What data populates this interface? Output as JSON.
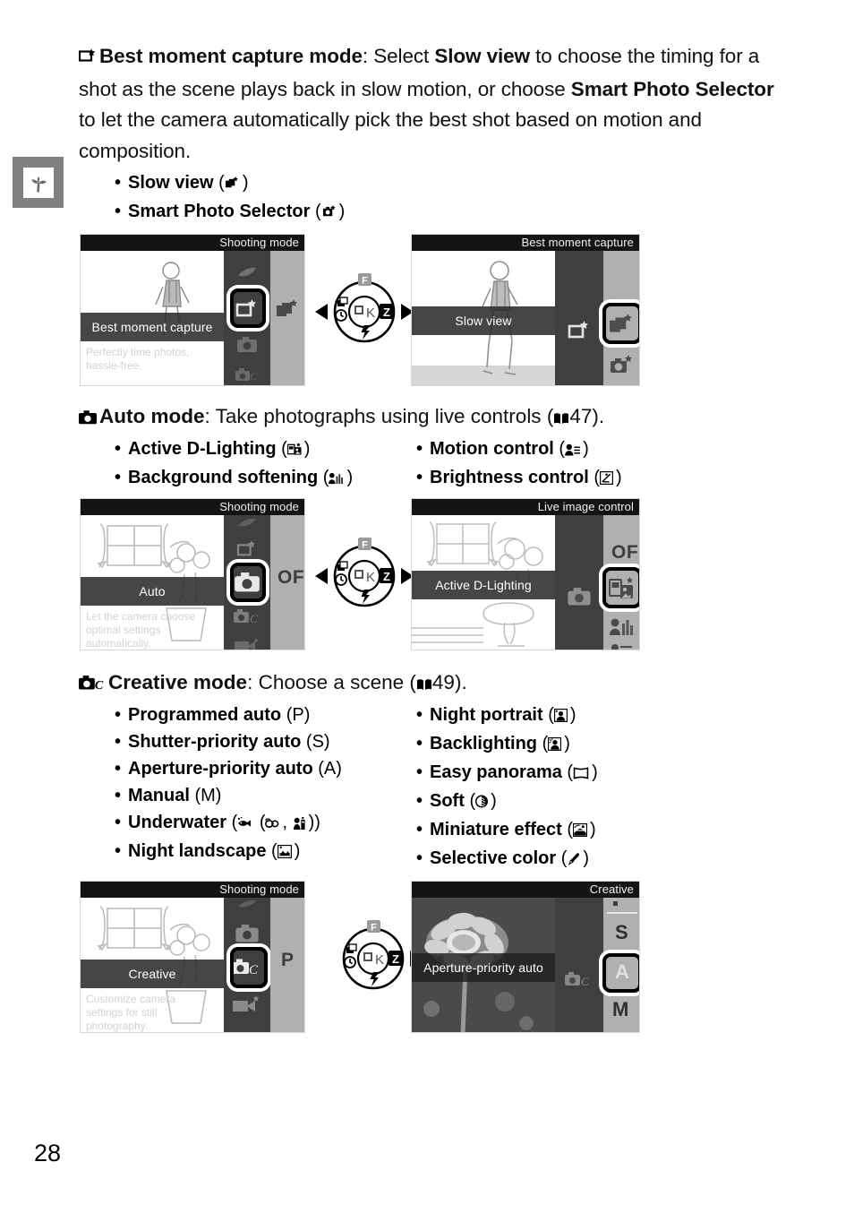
{
  "page": {
    "number": "28",
    "chapter_tab_icon": "sprout-icon"
  },
  "best_moment": {
    "heading_icon": "best-moment-capture-icon",
    "heading_bold": "Best moment capture mode",
    "heading_rest": ": Select ",
    "body_bold_1": "Slow view",
    "body_part_2": " to choose the timing for a shot as the scene plays back in slow motion, or choose ",
    "body_bold_2": "Smart Photo Selector",
    "body_part_3": " to let the camera automatically pick the best shot based on motion and composition.",
    "bullets": [
      {
        "label": "Slow view",
        "icon": "slow-view-icon"
      },
      {
        "label": "Smart Photo Selector",
        "icon": "smart-photo-selector-icon"
      }
    ],
    "shot_left": {
      "title": "Shooting mode",
      "selected_label": "Best moment capture",
      "description": "Perfectly time photos,\nhassle-free.",
      "strip_icons": [
        "effects-icon",
        "best-moment-capture-icon",
        "auto-camera-icon",
        "creative-camera-icon"
      ],
      "col2_icons": [
        "slow-view-icon"
      ]
    },
    "shot_right": {
      "title": "Best moment capture",
      "selected_label": "Slow view",
      "strip_icons": [
        "best-moment-capture-icon"
      ],
      "col2_icons": [
        "slow-view-icon",
        "smart-photo-selector-icon"
      ]
    }
  },
  "auto_mode": {
    "heading_icon": "auto-camera-icon",
    "heading_bold": "Auto mode",
    "heading_rest": ": Take photographs using live controls (",
    "page_ref": "47",
    "heading_tail": ").",
    "bullets_left": [
      {
        "label": "Active D-Lighting",
        "icon": "active-d-lighting-icon"
      },
      {
        "label": "Background softening",
        "icon": "background-softening-icon"
      }
    ],
    "bullets_right": [
      {
        "label": "Motion control",
        "icon": "motion-control-icon"
      },
      {
        "label": "Brightness control",
        "icon": "brightness-control-icon"
      }
    ],
    "shot_left": {
      "title": "Shooting mode",
      "selected_label": "Auto",
      "description": "Let the camera choose\noptimal settings\nautomatically.",
      "strip_icons": [
        "effects-icon",
        "best-moment-capture-icon",
        "auto-camera-icon",
        "creative-camera-icon",
        "movie-icon"
      ],
      "col2_text": "OFF"
    },
    "shot_right": {
      "title": "Live image control",
      "selected_label": "Active D-Lighting",
      "strip_icons": [
        "auto-camera-icon"
      ],
      "col2_text": "OFF",
      "col2_icons": [
        "active-d-lighting-icon",
        "background-softening-icon",
        "motion-control-icon"
      ]
    }
  },
  "creative_mode": {
    "heading_icon": "creative-camera-icon",
    "heading_bold": "Creative mode",
    "heading_rest": ": Choose a scene (",
    "page_ref": "49",
    "heading_tail": ").",
    "bullets_left": [
      {
        "label": "Programmed auto",
        "paren": "(P)"
      },
      {
        "label": "Shutter-priority auto",
        "paren": "(S)"
      },
      {
        "label": "Aperture-priority auto",
        "paren": "(A)"
      },
      {
        "label": "Manual",
        "paren": "(M)"
      },
      {
        "label": "Underwater",
        "paren": "(  (  ,  ))",
        "icons": [
          "underwater-fish-icon",
          "underwater-mask-icon",
          "underwater-diver-icon"
        ]
      },
      {
        "label": "Night landscape",
        "paren": "(  )",
        "icons": [
          "night-landscape-icon"
        ]
      }
    ],
    "bullets_right": [
      {
        "label": "Night portrait",
        "paren": "(  )",
        "icons": [
          "night-portrait-icon"
        ]
      },
      {
        "label": "Backlighting",
        "paren": "(  )",
        "icons": [
          "backlighting-icon"
        ]
      },
      {
        "label": "Easy panorama",
        "paren": "(  )",
        "icons": [
          "easy-panorama-icon"
        ]
      },
      {
        "label": "Soft",
        "paren": "(  )",
        "icons": [
          "soft-icon"
        ]
      },
      {
        "label": "Miniature effect",
        "paren": "(  )",
        "icons": [
          "miniature-effect-icon"
        ]
      },
      {
        "label": "Selective color",
        "paren": "(  )",
        "icons": [
          "selective-color-icon"
        ]
      }
    ],
    "shot_left": {
      "title": "Shooting mode",
      "selected_label": "Creative",
      "description": "Customize camera\nsettings for still\nphotography.",
      "strip_icons": [
        "effects-icon",
        "auto-camera-icon",
        "creative-camera-icon",
        "movie-icon"
      ],
      "col2_text": "P"
    },
    "shot_right": {
      "title": "Creative",
      "selected_label": "Aperture-priority auto",
      "strip_icons": [
        "creative-camera-icon"
      ],
      "col2_letters": [
        "S",
        "A",
        "M"
      ]
    }
  },
  "multi_selector": {
    "center_label": "OK",
    "top": "F",
    "bottom": "flash-icon",
    "left": "burst-timer-icon",
    "right": "exposure-comp-icon"
  },
  "colors": {
    "tab_gray": "#808080",
    "screen_dark": "#141414",
    "strip_gray": "#3f3f3f",
    "col2_gray": "#b0b0b0"
  }
}
